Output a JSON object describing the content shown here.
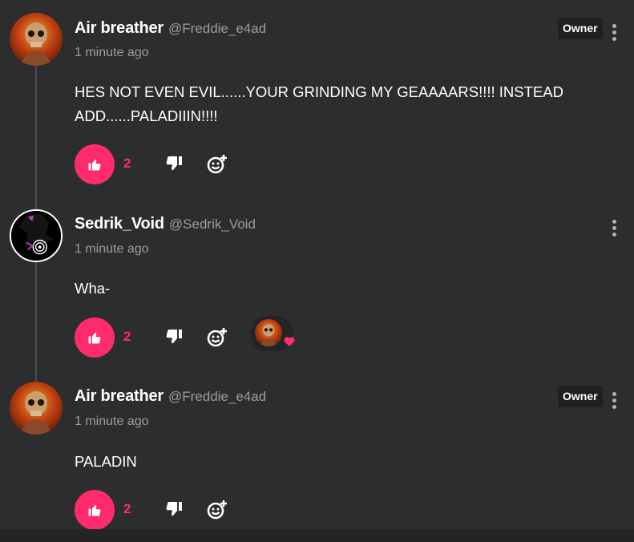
{
  "comments": [
    {
      "author": "Air breather",
      "handle": "@Freddie_e4ad",
      "time": "1 minute ago",
      "badge": "Owner",
      "text": "HES NOT EVEN EVIL......YOUR GRINDING MY GEAAAARS!!!! INSTEAD ADD......PALADIIIN!!!!",
      "likes": "2"
    },
    {
      "author": "Sedrik_Void",
      "handle": "@Sedrik_Void",
      "time": "1 minute ago",
      "text": "Wha-",
      "likes": "2"
    },
    {
      "author": "Air breather",
      "handle": "@Freddie_e4ad",
      "time": "1 minute ago",
      "badge": "Owner",
      "text": "PALADIN",
      "likes": "2"
    }
  ],
  "colors": {
    "accent": "#ff2b6b",
    "background": "#2b2d2e",
    "muted": "#9a9c9e"
  },
  "icons": [
    "thumbs-up-icon",
    "thumbs-down-icon",
    "add-reaction-icon",
    "more-vertical-icon",
    "heart-icon"
  ]
}
